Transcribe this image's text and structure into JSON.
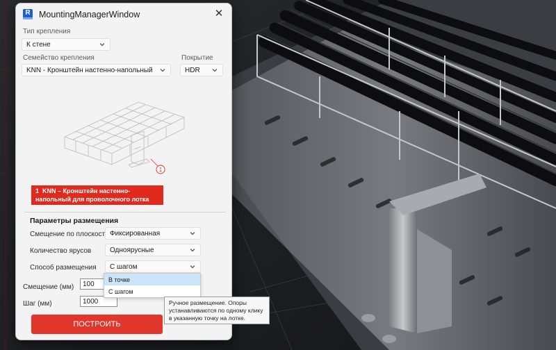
{
  "window": {
    "title": "MountingManagerWindow",
    "app_icon_letter": "R",
    "close_glyph": "✕"
  },
  "mount_type": {
    "label": "Тип крепления",
    "value": "К стене"
  },
  "mount_family": {
    "label": "Семейство крепления",
    "value": "KNN - Кронштейн настенно-напольный"
  },
  "coating": {
    "label": "Покрытие",
    "value": "HDR"
  },
  "preview": {
    "callout_number": "1",
    "banner_number": "1",
    "banner_code": "KNN",
    "banner_text": " – Кронштейн настенно-напольный для проволочного лотка"
  },
  "placement": {
    "section_title": "Параметры размещения",
    "offset_plane_label": "Смещение по плоскости",
    "offset_plane_value": "Фиксированная",
    "tiers_label": "Количество ярусов",
    "tiers_value": "Одноярусные",
    "method_label": "Способ размещения",
    "method_value": "С шагом",
    "offset_label": "Смещение (мм)",
    "offset_value": "100",
    "step_label": "Шаг (мм)",
    "step_value": "1000"
  },
  "method_dropdown": {
    "options": [
      "В точке",
      "С шагом"
    ],
    "highlighted_index": 0
  },
  "tooltip": {
    "text": "Ручное размещение. Опоры устанавливаются по одному клику в указанную точку на лотке."
  },
  "build_button": {
    "label": "ПОСТРОИТЬ"
  },
  "colors": {
    "accent_red": "#e0362b",
    "banner_red": "#e12a1e",
    "dropdown_highlight": "#cce4f7",
    "window_bg": "#f3f3f3"
  }
}
